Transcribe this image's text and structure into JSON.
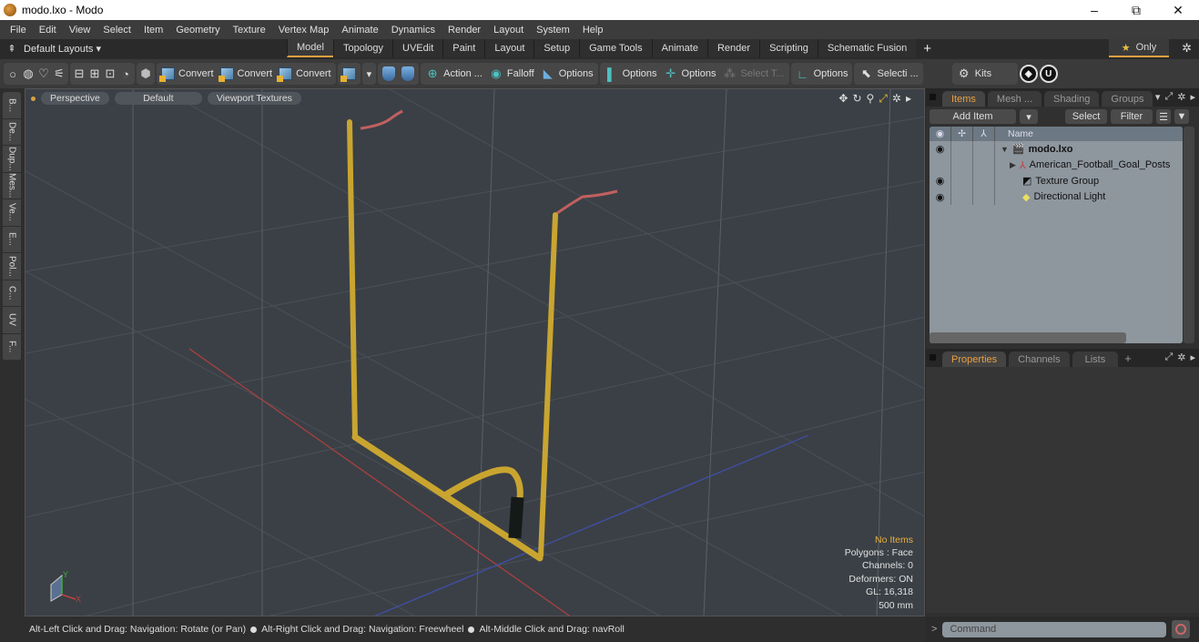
{
  "window": {
    "title": "modo.lxo - Modo",
    "minimize": "–",
    "restore": "⧉",
    "close": "✕"
  },
  "menu": [
    "File",
    "Edit",
    "View",
    "Select",
    "Item",
    "Geometry",
    "Texture",
    "Vertex Map",
    "Animate",
    "Dynamics",
    "Render",
    "Layout",
    "System",
    "Help"
  ],
  "layoutbar": {
    "layouts_label": "Default Layouts ▾",
    "tabs": [
      "Model",
      "Topology",
      "UVEdit",
      "Paint",
      "Layout",
      "Setup",
      "Game Tools",
      "Animate",
      "Render",
      "Scripting",
      "Schematic Fusion"
    ],
    "active_tab": "Model",
    "only_label": "Only"
  },
  "toolbar": {
    "convert1": "Convert",
    "convert2": "Convert",
    "convert3": "Convert",
    "action": "Action ...",
    "falloff": "Falloff",
    "options1": "Options",
    "options2": "Options",
    "options3": "Options",
    "select_t": "Select T...",
    "options4": "Options",
    "selecti": "Selecti ...",
    "kits": "Kits"
  },
  "left_tabs": [
    "B...",
    "De...",
    "Dup...",
    "Mes...",
    "Ve...",
    "E...",
    "Pol...",
    "C...",
    "UV",
    "F..."
  ],
  "viewport": {
    "view_mode": "Perspective",
    "shading": "Default",
    "textures": "Viewport Textures",
    "info": {
      "selection": "No Items",
      "polygons": "Polygons : Face",
      "channels": "Channels: 0",
      "deformers": "Deformers: ON",
      "gl": "GL: 16,318",
      "scale": "500 mm"
    },
    "axis_labels": {
      "x": "X",
      "y": "Y"
    }
  },
  "items_panel": {
    "tabs": [
      "Items",
      "Mesh ...",
      "Shading",
      "Groups"
    ],
    "active_tab": "Items",
    "add_item": "Add Item",
    "select": "Select",
    "filter": "Filter",
    "name_header": "Name",
    "items": [
      {
        "name": "modo.lxo",
        "visible": true,
        "bold": true,
        "icon": "scene-icon",
        "expander": "▼"
      },
      {
        "name": "American_Football_Goal_Posts",
        "visible": false,
        "bold": false,
        "icon": "mesh-locator-icon",
        "expander": "▶"
      },
      {
        "name": "Texture Group",
        "visible": true,
        "bold": false,
        "icon": "texture-group-icon",
        "expander": ""
      },
      {
        "name": "Directional Light",
        "visible": true,
        "bold": false,
        "icon": "light-icon",
        "expander": ""
      }
    ]
  },
  "properties_panel": {
    "tabs": [
      "Properties",
      "Channels",
      "Lists"
    ],
    "active_tab": "Properties"
  },
  "command": {
    "placeholder": "Command",
    "prompt": ">"
  },
  "status": {
    "hint1": "Alt-Left Click and Drag: Navigation: Rotate (or Pan)",
    "hint2": "Alt-Right Click and Drag: Navigation: Freewheel",
    "hint3": "Alt-Middle Click and Drag: navRoll"
  },
  "colors": {
    "accent": "#e8a040",
    "viewport_bg": "#3b4046",
    "goal_post": "#c9a530",
    "x_axis": "#b04040",
    "z_axis": "#4050b0"
  }
}
